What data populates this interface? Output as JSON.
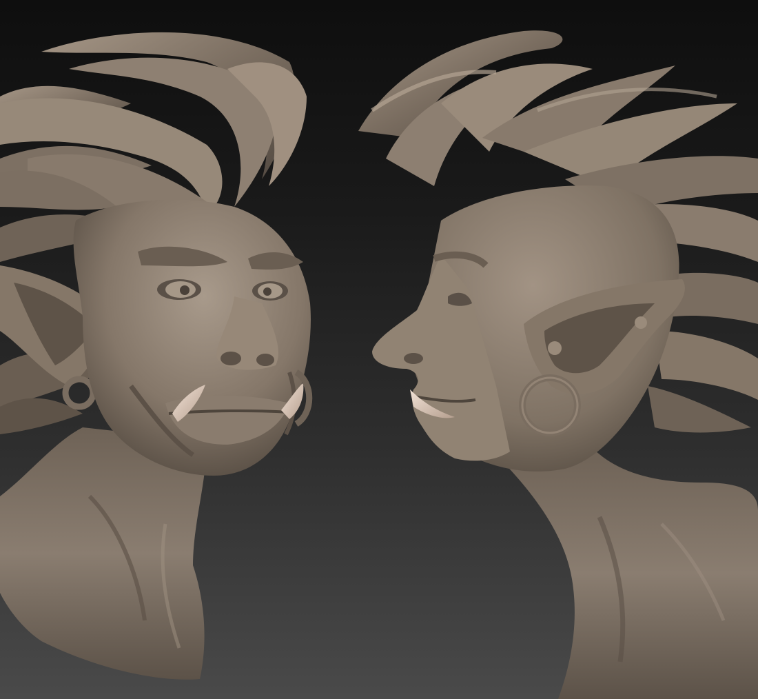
{
  "scene": {
    "background": {
      "top_color": "#0e0e0e",
      "bottom_color": "#4a4a4a"
    },
    "material_color": "#8c7f73",
    "material_shadow": "#4f463e",
    "material_highlight": "#b8ab9c",
    "tusk_color": "#e3cfc0",
    "views": [
      {
        "name": "front-three-quarter-view",
        "subject": "orc-bust"
      },
      {
        "name": "side-profile-view",
        "subject": "orc-bust"
      }
    ]
  }
}
